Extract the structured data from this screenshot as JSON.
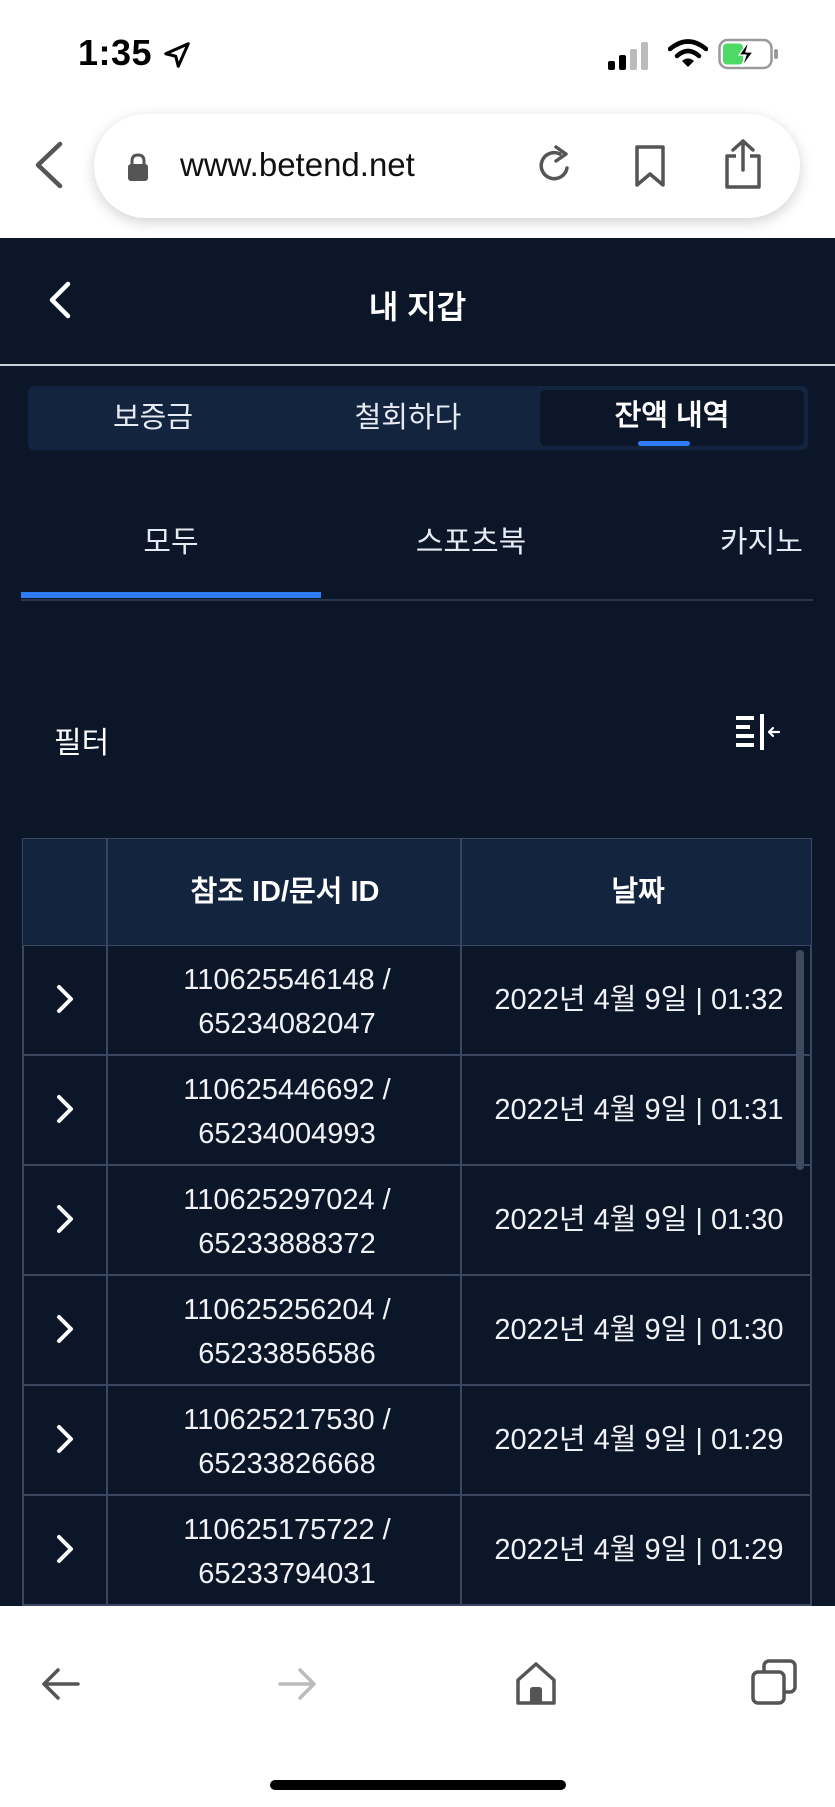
{
  "status_bar": {
    "time": "1:35"
  },
  "browser": {
    "url": "www.betend.net"
  },
  "app": {
    "title": "내 지갑",
    "segments": [
      {
        "label": "보증금"
      },
      {
        "label": "철회하다"
      },
      {
        "label": "잔액 내역"
      }
    ],
    "subtabs": [
      {
        "label": "모두"
      },
      {
        "label": "스포츠북"
      },
      {
        "label": "카지노"
      }
    ],
    "filter_label": "필터",
    "table": {
      "headers": {
        "ref": "참조 ID/문서 ID",
        "date": "날짜"
      },
      "rows": [
        {
          "ref_line1": "110625546148 /",
          "ref_line2": "65234082047",
          "date": "2022년 4월 9일 | 01:32"
        },
        {
          "ref_line1": "110625446692 /",
          "ref_line2": "65234004993",
          "date": "2022년 4월 9일 | 01:31"
        },
        {
          "ref_line1": "110625297024 /",
          "ref_line2": "65233888372",
          "date": "2022년 4월 9일 | 01:30"
        },
        {
          "ref_line1": "110625256204 /",
          "ref_line2": "65233856586",
          "date": "2022년 4월 9일 | 01:30"
        },
        {
          "ref_line1": "110625217530 /",
          "ref_line2": "65233826668",
          "date": "2022년 4월 9일 | 01:29"
        },
        {
          "ref_line1": "110625175722 /",
          "ref_line2": "65233794031",
          "date": "2022년 4월 9일 | 01:29"
        }
      ]
    }
  },
  "colors": {
    "accent": "#2e7cf6",
    "background": "#0c1629",
    "panel": "#13243f"
  }
}
